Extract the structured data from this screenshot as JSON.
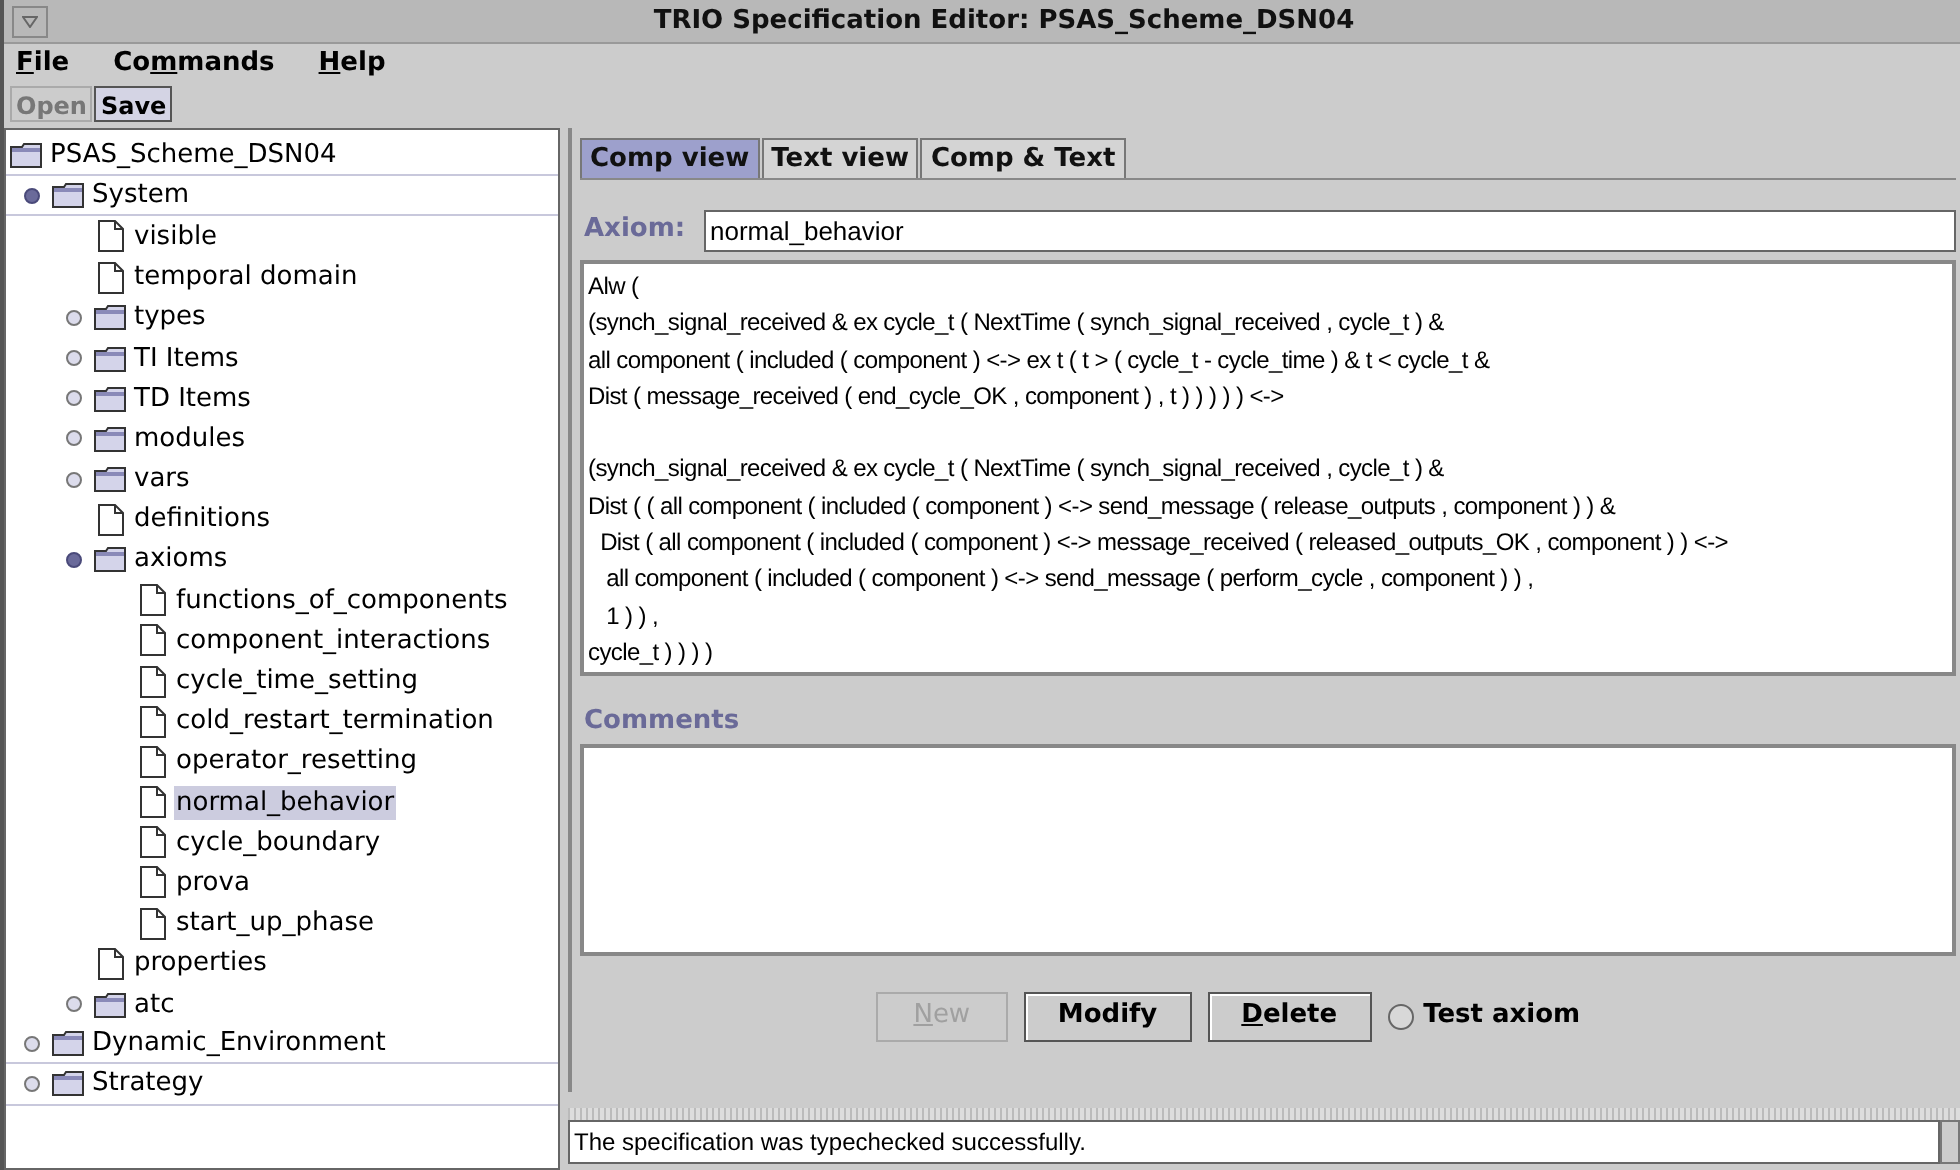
{
  "window": {
    "title": "TRIO Specification Editor: PSAS_Scheme_DSN04"
  },
  "menu": [
    {
      "parts": [
        {
          "text": "F",
          "underlined": true
        },
        {
          "text": "ile",
          "underlined": false
        }
      ]
    },
    {
      "parts": [
        {
          "text": "Co",
          "underlined": false
        },
        {
          "text": "m",
          "underlined": true
        },
        {
          "text": "mands",
          "underlined": false
        }
      ]
    },
    {
      "parts": [
        {
          "text": "H",
          "underlined": true
        },
        {
          "text": "elp",
          "underlined": false
        }
      ]
    }
  ],
  "toolbar": [
    {
      "label": "Open",
      "disabled": true
    },
    {
      "label": "Save",
      "disabled": false
    }
  ],
  "tree": {
    "root": "PSAS_Scheme_DSN04",
    "items": [
      {
        "label": "System",
        "kind": "folder",
        "expanded": true,
        "selected": false,
        "children": [
          {
            "label": "visible",
            "kind": "file",
            "selected": false
          },
          {
            "label": "temporal domain",
            "kind": "file",
            "selected": false
          },
          {
            "label": "types",
            "kind": "folder",
            "expanded": false,
            "selected": false
          },
          {
            "label": "TI Items",
            "kind": "folder",
            "expanded": false,
            "selected": false
          },
          {
            "label": "TD Items",
            "kind": "folder",
            "expanded": false,
            "selected": false
          },
          {
            "label": "modules",
            "kind": "folder",
            "expanded": false,
            "selected": false
          },
          {
            "label": "vars",
            "kind": "folder",
            "expanded": false,
            "selected": false
          },
          {
            "label": "definitions",
            "kind": "file",
            "selected": false
          },
          {
            "label": "axioms",
            "kind": "folder",
            "expanded": true,
            "selected": false,
            "children": [
              {
                "label": "functions_of_components",
                "kind": "file",
                "selected": false
              },
              {
                "label": "component_interactions",
                "kind": "file",
                "selected": false
              },
              {
                "label": "cycle_time_setting",
                "kind": "file",
                "selected": false
              },
              {
                "label": "cold_restart_termination",
                "kind": "file",
                "selected": false
              },
              {
                "label": "operator_resetting",
                "kind": "file",
                "selected": false
              },
              {
                "label": "normal_behavior",
                "kind": "file",
                "selected": true
              },
              {
                "label": "cycle_boundary",
                "kind": "file",
                "selected": false
              },
              {
                "label": "prova",
                "kind": "file",
                "selected": false
              },
              {
                "label": "start_up_phase",
                "kind": "file",
                "selected": false
              }
            ]
          },
          {
            "label": "properties",
            "kind": "file",
            "selected": false
          },
          {
            "label": "atc",
            "kind": "folder",
            "expanded": false,
            "selected": false
          }
        ]
      },
      {
        "label": "Dynamic_Environment",
        "kind": "folder",
        "expanded": false,
        "selected": false
      },
      {
        "label": "Strategy",
        "kind": "folder",
        "expanded": false,
        "selected": false
      }
    ]
  },
  "tabs": [
    {
      "label": "Comp view",
      "selected": true
    },
    {
      "label": "Text view",
      "selected": false
    },
    {
      "label": "Comp & Text",
      "selected": false
    }
  ],
  "axiom": {
    "label": "Axiom:",
    "value": "normal_behavior"
  },
  "formula": [
    [
      "Alw (",
      "(synch_signal_received & ex cycle_t ( NextTime ( synch_signal_received , cycle_t ) &",
      "all component ( included ( component ) <-> ex t ( t > ( cycle_t - cycle_time ) & t < cycle_t &",
      "Dist ( message_received ( end_cycle_OK , component ) , t ) ) ) ) ) <->"
    ],
    [
      "(synch_signal_received & ex cycle_t ( NextTime ( synch_signal_received , cycle_t ) &",
      "Dist ( ( all component ( included ( component ) <-> send_message ( release_outputs , component ) ) &",
      "  Dist ( all component ( included ( component ) <-> message_received ( released_outputs_OK , component ) ) <->",
      "   all component ( included ( component ) <-> send_message ( perform_cycle , component ) ) ,",
      "   1 ) ) ,",
      "cycle_t ) ) ) )"
    ]
  ],
  "comments": {
    "label": "Comments"
  },
  "buttons": [
    {
      "parts": [
        {
          "text": "N",
          "underlined": true
        },
        {
          "text": "ew",
          "underlined": false
        }
      ],
      "disabled": true
    },
    {
      "parts": [
        {
          "text": "Modify",
          "underlined": false
        }
      ],
      "disabled": false
    },
    {
      "parts": [
        {
          "text": "D",
          "underlined": true
        },
        {
          "text": "elete",
          "underlined": false
        }
      ],
      "disabled": false
    }
  ],
  "test_axiom": {
    "label": "Test axiom",
    "checked": false
  },
  "status": "The specification was typechecked successfully."
}
